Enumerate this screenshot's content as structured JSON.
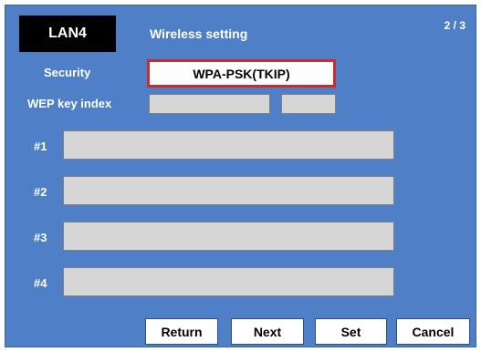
{
  "header": {
    "lan_label": "LAN4",
    "title": "Wireless setting",
    "page_indicator": "2 / 3"
  },
  "security": {
    "label": "Security",
    "value": "WPA-PSK(TKIP)"
  },
  "wep_key_index": {
    "label": "WEP key index",
    "value1": "",
    "value2": ""
  },
  "keys": [
    {
      "label": "#1",
      "value": ""
    },
    {
      "label": "#2",
      "value": ""
    },
    {
      "label": "#3",
      "value": ""
    },
    {
      "label": "#4",
      "value": ""
    }
  ],
  "buttons": {
    "return": "Return",
    "next": "Next",
    "set": "Set",
    "cancel": "Cancel"
  },
  "colors": {
    "background": "#4f80c7",
    "header_badge": "#000000",
    "field": "#d6d6d6",
    "selected_border": "#cc2b2b"
  }
}
